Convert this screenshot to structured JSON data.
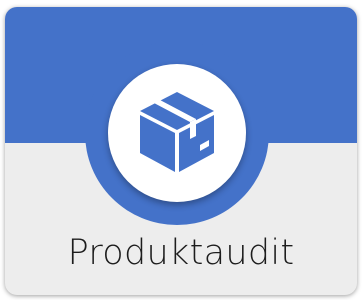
{
  "tile": {
    "label": "Produktaudit",
    "icon": "package-box-icon",
    "accent_color": "#4472c9",
    "background_color": "#ededed",
    "icon_color": "#4472c9"
  }
}
